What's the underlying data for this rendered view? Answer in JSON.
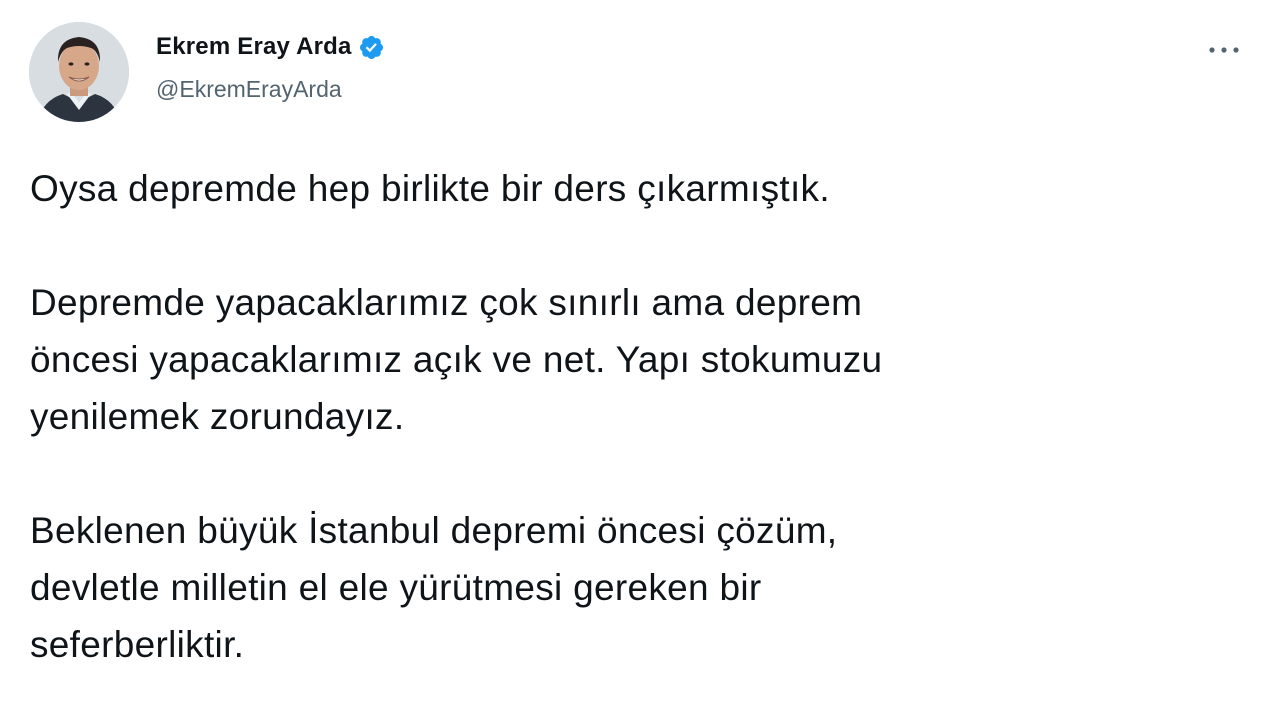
{
  "tweet": {
    "author": {
      "display_name": "Ekrem Eray Arda",
      "handle": "@EkremErayArda",
      "verified": true,
      "verified_icon": "verified-badge-icon",
      "avatar_icon": "profile-photo-avatar"
    },
    "more_icon": "more-options-icon",
    "paragraphs": [
      {
        "lines": [
          "Oysa depremde hep birlikte bir ders çıkarmıştık."
        ]
      },
      {
        "lines": [
          "Depremde yapacaklarımız çok sınırlı ama deprem",
          "öncesi yapacaklarımız açık ve net. Yapı stokumuzu",
          "yenilemek zorundayız."
        ]
      },
      {
        "lines": [
          "Beklenen büyük İstanbul depremi öncesi çözüm,",
          "devletle milletin el ele yürütmesi gereken bir",
          "seferberliktir."
        ]
      }
    ]
  },
  "colors": {
    "text_primary": "#0f1419",
    "text_secondary": "#536471",
    "verified_blue": "#1d9bf0"
  }
}
